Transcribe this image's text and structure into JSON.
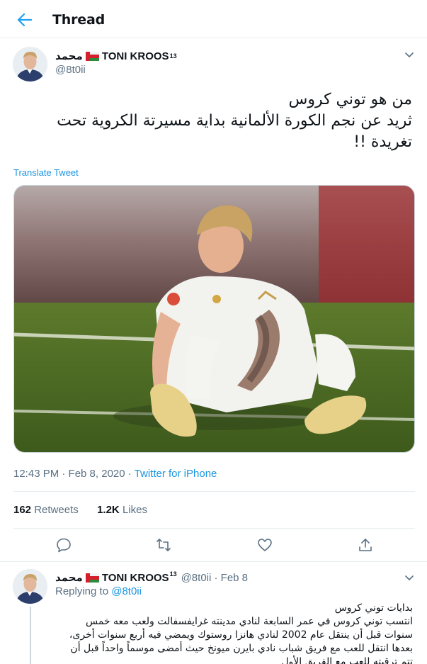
{
  "header": {
    "title": "Thread",
    "back_icon": "arrow-left-icon",
    "accent": "#1da1f2"
  },
  "tweet": {
    "author_name": "محمد",
    "author_name_2": "TONI KROOS",
    "author_sup": "13",
    "flag_icon": "oman-flag-icon",
    "handle": "@8t0ii",
    "text_line1": "من هو توني كروس",
    "text_line2": "ثريد عن نجم الكورة الألمانية بداية مسيرتة الكروية تحت",
    "text_line3": "تغريدة !!",
    "translate_label": "Translate Tweet",
    "time": "12:43 PM · Feb 8, 2020 · ",
    "source": "Twitter for iPhone",
    "retweets_count": "162",
    "retweets_label": "Retweets",
    "likes_count": "1.2K",
    "likes_label": "Likes"
  },
  "actions": [
    "reply-icon",
    "retweet-icon",
    "like-icon",
    "share-icon"
  ],
  "reply": {
    "author_name": "محمد",
    "author_name_2": "TONI KROOS",
    "author_sup": "13",
    "handle_date": "@8t0ii · Feb 8",
    "replying_prefix": "Replying to ",
    "replying_to": "@8t0ii",
    "line1": "بدايات توني كروس",
    "line2": "انتسب توني كروس في عمر السابعة لنادي مدينته غرايفسفالت ولعب معه خمس",
    "line3": "سنوات قبل أن ينتقل عام 2002 لنادي هانزا روستوك ويمضي فيه أربع سنوات أخرى،",
    "line4": "بعدها انتقل للعب مع فريق شباب نادي بايرن ميونخ حيث أمضى موسماً واحداً قبل أن",
    "line5": "تتم ترقيته للعب مع الفريق الأول"
  }
}
